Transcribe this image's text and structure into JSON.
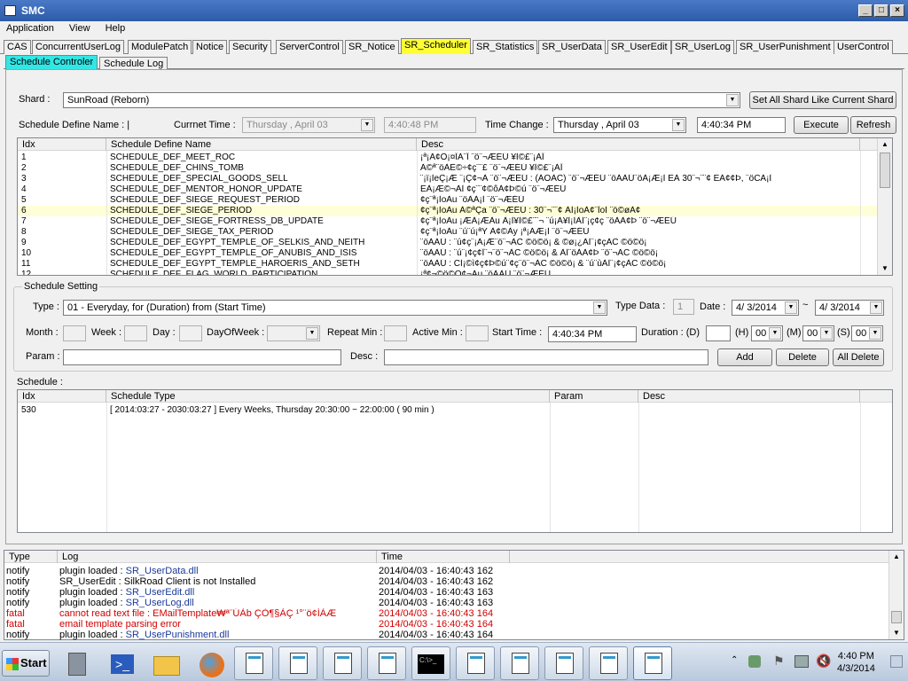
{
  "window": {
    "title": "SMC"
  },
  "menu": [
    "Application",
    "View",
    "Help"
  ],
  "tabs": [
    "CAS",
    "ConcurrentUserLog",
    "ModulePatch",
    "Notice",
    "Security",
    "ServerControl",
    "SR_Notice",
    "SR_Scheduler",
    "SR_Statistics",
    "SR_UserData",
    "SR_UserEdit",
    "SR_UserLog",
    "SR_UserPunishment",
    "UserControl"
  ],
  "active_tab": "SR_Scheduler",
  "subtabs": [
    "Schedule Controler",
    "Schedule Log"
  ],
  "shard": {
    "label": "Shard :",
    "value": "SunRoad (Reborn)",
    "set_all_button": "Set All Shard Like Current Shard"
  },
  "controls": {
    "define_label": "Schedule Define Name : |",
    "current_time_label": "Currnet Time :",
    "current_date": "Thursday ,    April    03",
    "current_time": "4:40:48 PM",
    "time_change_label": "Time Change :",
    "change_date": "Thursday ,    April    03",
    "change_time": "4:40:34 PM",
    "execute_button": "Execute",
    "refresh_button": "Refresh"
  },
  "define_grid": {
    "headers": [
      "Idx",
      "Schedule Define Name",
      "Desc"
    ],
    "rows": [
      [
        "1",
        "SCHEDULE_DEF_MEET_ROC",
        "¡ª¡Ã¢Ô¡¤ÏÀ¨Ï ¨ö¨¬ÆÉÚ ¥Ì©£¨¡ÀÏ"
      ],
      [
        "2",
        "SCHEDULE_DEF_CHINS_TOMB",
        "À©ª¨öÀÈ©÷¢ç¨¨£ ¨ö¨¬ÆÉÚ ¥Ì©£¨¡ÀÏ"
      ],
      [
        "3",
        "SCHEDULE_DEF_SPECIAL_GOODS_SELL",
        "¨¡ï¡ÌeÇ¡Æ ¨¡Ç¢¬À ¨ö¨¬ÆÉÚ : (ÀOÀC) ¨ö¨¬ÆÉÚ ¨öÀÀÚ¨öÀ¡Æ¡Ì EÀ 30¨¬¨¨¢ EÀ¢¢Þ, ¨öCÀ¡Ì"
      ],
      [
        "4",
        "SCHEDULE_DEF_MENTOR_HONOR_UPDATE",
        "EÀ¡Æ©¬ÀÌ ¢ç¨¨¢©ôÀ¢Þ©ú ¨ö¨¬ÆÉÚ"
      ],
      [
        "5",
        "SCHEDULE_DEF_SIEGE_REQUEST_PERIOD",
        "¢ç¨ª¡ÌoÀu ¨öÀÀ¡Ì ¨ö¨¬ÆÉÚ"
      ],
      [
        "6",
        "SCHEDULE_DEF_SIEGE_PERIOD",
        "¢ç¨ª¡ÌoÀu À©ªÇa ¨ö¨¬ÆÉÚ : 30¨¬¨¨¢ ÀÌ¡ÌoÀ¢¨ÏoÌ ¨ö©øÀ¢"
      ],
      [
        "7",
        "SCHEDULE_DEF_SIEGE_FORTRESS_DB_UPDATE",
        "¢ç¨ª¡ÌoÀu ¡ÆÀ¡ÆÀu À¡Ì¥Ì©£¨¨¬ ¨ú¡À¥Ì¡ÌÀÌ¨¡ç¢ç ¨öÀÀ¢Þ ¨ö¨¬ÆÉÚ"
      ],
      [
        "8",
        "SCHEDULE_DEF_SIEGE_TAX_PERIOD",
        "¢ç¨ª¡ÌoÀu ¨ú¨ú¡ªÝ À¢©Ày ¡ª¡ÀÆ¡Ì ¨ö¨¬ÆÉÚ"
      ],
      [
        "9",
        "SCHEDULE_DEF_EGYPT_TEMPLE_OF_SELKIS_AND_NEITH",
        "¨öÀÀÚ : ¨ú¢ç¨¡À¡Æ¨ö¨¬ÀC ©ö©ö¡ & ©ø¡¿ÀÌ¨¡¢çÀC ©ö©ö¡"
      ],
      [
        "10",
        "SCHEDULE_DEF_EGYPT_TEMPLE_OF_ANUBIS_AND_ISIS",
        "¨öÀÀÚ : ¨ú¨¡¢ç¢Ï¨¬¨ö¨¬ÀC ©ö©ö¡ & ÀÌ¨öÀÀ¢Þ ¨ö¨¬ÀC ©ö©ö¡"
      ],
      [
        "11",
        "SCHEDULE_DEF_EGYPT_TEMPLE_HAROERIS_AND_SETH",
        "¨öÀÀÚ : CÌ¡©ì¢ç¢Þ©ú¨¢ç¨ö¨¬ÀC ©ö©ö¡ & ¨ú¨ùÀÌ¨¡¢çÀC ©ö©ö¡"
      ],
      [
        "12",
        "SCHEDULE_DEF_FLAG_WORLD_PARTICIPATION",
        "¡ª¢¬©ö©Ò¢¬Àu ¨öÀÀÚ ¨ö¨¬ÆÉÚ"
      ]
    ],
    "selected_row": 6
  },
  "setting": {
    "group_label": "Schedule Setting",
    "type_label": "Type :",
    "type_value": "01 - Everyday, for (Duration) from (Start Time)",
    "type_data_label": "Type Data :",
    "type_data_value": "1",
    "date_label": "Date :",
    "date_from": "4/ 3/2014",
    "date_sep": "~",
    "date_to": "4/ 3/2014",
    "month_label": "Month :",
    "week_label": "Week :",
    "day_label": "Day :",
    "dow_label": "DayOfWeek :",
    "repeat_label": "Repeat Min :",
    "active_label": "Active Min :",
    "start_label": "Start Time :",
    "start_value": "4:40:34 PM",
    "duration_label": "Duration : (D)",
    "h_label": "(H)",
    "h_value": "00",
    "m_label": "(M)",
    "m_value": "00",
    "s_label": "(S)",
    "s_value": "00",
    "param_label": "Param :",
    "desc_label": "Desc :",
    "add_button": "Add",
    "delete_button": "Delete",
    "all_delete_button": "All Delete"
  },
  "schedule": {
    "label": "Schedule :",
    "headers": [
      "Idx",
      "Schedule Type",
      "Param",
      "Desc"
    ],
    "rows": [
      [
        "530",
        "[ 2014:03:27 - 2030:03:27 ] Every Weeks, Thursday 20:30:00 ~ 22:00:00 ( 90 min )",
        "",
        ""
      ]
    ]
  },
  "log": {
    "headers": [
      "Type",
      "Log",
      "Time"
    ],
    "rows": [
      {
        "type": "notify",
        "pre": "plugin loaded : ",
        "link": "SR_UserData.dll",
        "time": "2014/04/03 - 16:40:43 162",
        "fatal": false
      },
      {
        "type": "notify",
        "pre": "SR_UserEdit : SilkRoad Client is not Installed",
        "link": "",
        "time": "2014/04/03 - 16:40:43 162",
        "fatal": false
      },
      {
        "type": "notify",
        "pre": "plugin loaded : ",
        "link": "SR_UserEdit.dll",
        "time": "2014/04/03 - 16:40:43 163",
        "fatal": false
      },
      {
        "type": "notify",
        "pre": "plugin loaded : ",
        "link": "SR_UserLog.dll",
        "time": "2014/04/03 - 16:40:43 163",
        "fatal": false
      },
      {
        "type": "fatal",
        "pre": "cannot read text file : EMailTemplate₩ª¨ÚÀb ÇÒ¶§ÀÇ ¹°¨ö¢ÍÀÆ",
        "link": "",
        "time": "2014/04/03 - 16:40:43 164",
        "fatal": true
      },
      {
        "type": "fatal",
        "pre": "email template parsing error",
        "link": "",
        "time": "2014/04/03 - 16:40:43 164",
        "fatal": true
      },
      {
        "type": "notify",
        "pre": "plugin loaded : ",
        "link": "SR_UserPunishment.dll",
        "time": "2014/04/03 - 16:40:43 164",
        "fatal": false
      }
    ]
  },
  "taskbar": {
    "start": "Start",
    "time": "4:40 PM",
    "date": "4/3/2014"
  },
  "colors": {
    "active_tab": "#ffff33",
    "active_subtab": "#33e6e6",
    "fatal": "#d00000",
    "link": "#1a3a9a"
  }
}
